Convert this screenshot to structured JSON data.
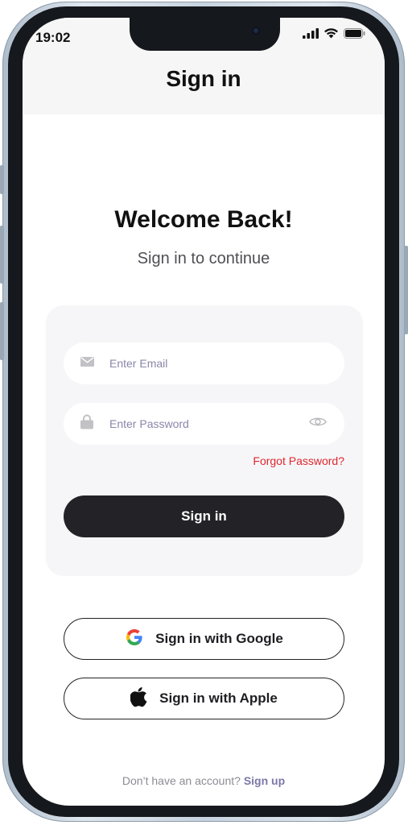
{
  "status_bar": {
    "time": "19:02",
    "icons": [
      "cellular-signal-icon",
      "wifi-icon",
      "battery-icon"
    ]
  },
  "nav": {
    "title": "Sign in"
  },
  "header": {
    "welcome": "Welcome Back!",
    "subtitle": "Sign in to continue"
  },
  "form": {
    "email_placeholder": "Enter Email",
    "password_placeholder": "Enter Password",
    "forgot_password": "Forgot Password?",
    "submit_label": "Sign in"
  },
  "social": {
    "google_label": "Sign in with Google",
    "apple_label": "Sign in with Apple"
  },
  "footer": {
    "prompt": "Don’t have an account?",
    "signup_link": "Sign up"
  },
  "colors": {
    "primary_button": "#232327",
    "forgot_link": "#e0262e",
    "signup_link": "#7b78a6",
    "placeholder": "#8a86a8",
    "card_background": "#f6f6f8"
  }
}
